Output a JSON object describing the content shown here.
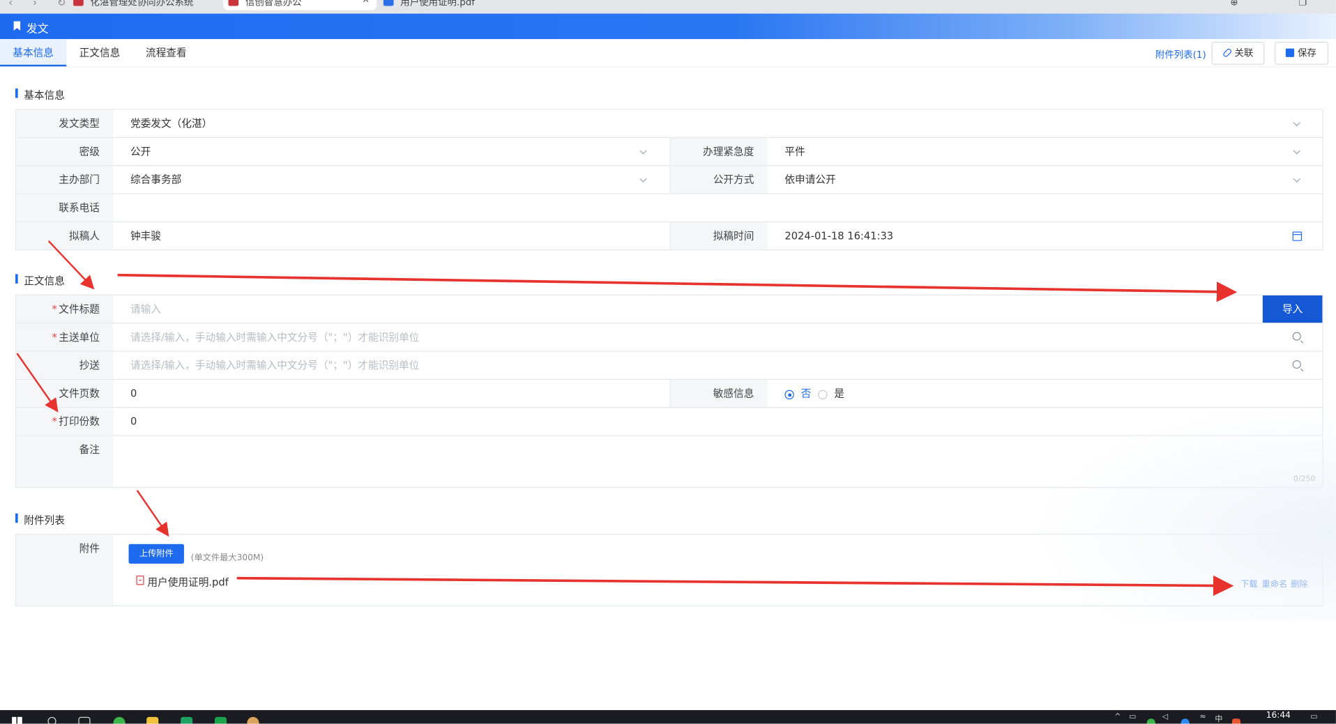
{
  "browser": {
    "tabs": [
      {
        "label": "化湛管理处协同办公系统"
      },
      {
        "label": "信创智慧办公"
      },
      {
        "label": "用户使用证明.pdf"
      }
    ]
  },
  "app": {
    "title": "发文"
  },
  "tabs": [
    {
      "label": "基本信息",
      "active": true
    },
    {
      "label": "正文信息",
      "active": false
    },
    {
      "label": "流程查看",
      "active": false
    }
  ],
  "header_actions": {
    "attachment_list": "附件列表(1)",
    "relate": "关联",
    "save": "保存"
  },
  "basic": {
    "section_title": "基本信息",
    "doc_type_label": "发文类型",
    "doc_type_value": "党委发文（化湛）",
    "secret_label": "密级",
    "secret_value": "公开",
    "urgency_label": "办理紧急度",
    "urgency_value": "平件",
    "dept_label": "主办部门",
    "dept_value": "综合事务部",
    "public_label": "公开方式",
    "public_value": "依申请公开",
    "phone_label": "联系电话",
    "phone_value": "",
    "drafter_label": "拟稿人",
    "drafter_value": "钟丰骏",
    "draft_time_label": "拟稿时间",
    "draft_time_value": "2024-01-18 16:41:33"
  },
  "body": {
    "section_title": "正文信息",
    "title_label": "文件标题",
    "title_placeholder": "请输入",
    "import_button": "导入",
    "main_unit_label": "主送单位",
    "unit_placeholder": "请选择/输入，手动输入时需输入中文分号（\"；\"）才能识别单位",
    "cc_label": "抄送",
    "pages_label": "文件页数",
    "pages_value": "0",
    "sensitive_label": "敏感信息",
    "sensitive_options": [
      "否",
      "是"
    ],
    "sensitive_selected": "否",
    "copies_label": "打印份数",
    "copies_value": "0",
    "remark_label": "备注",
    "remark_counter": "0/250",
    "required_mark": "*"
  },
  "attachments": {
    "section_title": "附件列表",
    "label": "附件",
    "upload_button": "上传附件",
    "upload_note": "(单文件最大300M)",
    "files": [
      {
        "name": "用户使用证明.pdf",
        "actions": [
          "下载",
          "重命名",
          "删除"
        ]
      }
    ]
  },
  "taskbar": {
    "time": "16:44",
    "ime": "中"
  },
  "colors": {
    "primary": "#1f6bf0",
    "import_button": "#1558d6",
    "annotation_arrow": "#e8322e",
    "required": "#e54545"
  }
}
